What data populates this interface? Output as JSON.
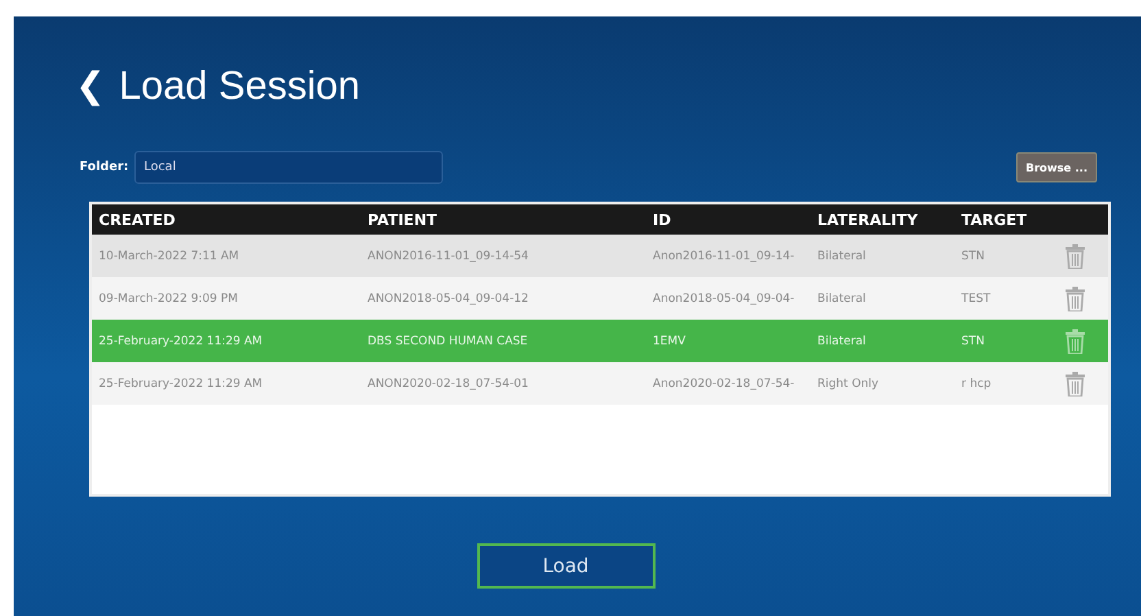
{
  "title": {
    "back_icon": "❮",
    "text": "Load Session"
  },
  "folder": {
    "label": "Folder:",
    "value": "Local"
  },
  "browse_button": "Browse ...",
  "table": {
    "columns": [
      "CREATED",
      "PATIENT",
      "ID",
      "LATERALITY",
      "TARGET"
    ],
    "rows": [
      {
        "cells": [
          "10-March-2022 7:11 AM",
          "ANON2016-11-01_09-14-54",
          "Anon2016-11-01_09-14-",
          "Bilateral",
          "STN"
        ],
        "selected": false
      },
      {
        "cells": [
          "09-March-2022 9:09 PM",
          "ANON2018-05-04_09-04-12",
          "Anon2018-05-04_09-04-",
          "Bilateral",
          "TEST"
        ],
        "selected": false
      },
      {
        "cells": [
          "25-February-2022 11:29 AM",
          "DBS SECOND HUMAN CASE",
          "1EMV",
          "Bilateral",
          "STN"
        ],
        "selected": true
      },
      {
        "cells": [
          "25-February-2022 11:29 AM",
          "ANON2020-02-18_07-54-01",
          "Anon2020-02-18_07-54-",
          "Right Only",
          "r hcp"
        ],
        "selected": false
      }
    ]
  },
  "load_button": "Load"
}
